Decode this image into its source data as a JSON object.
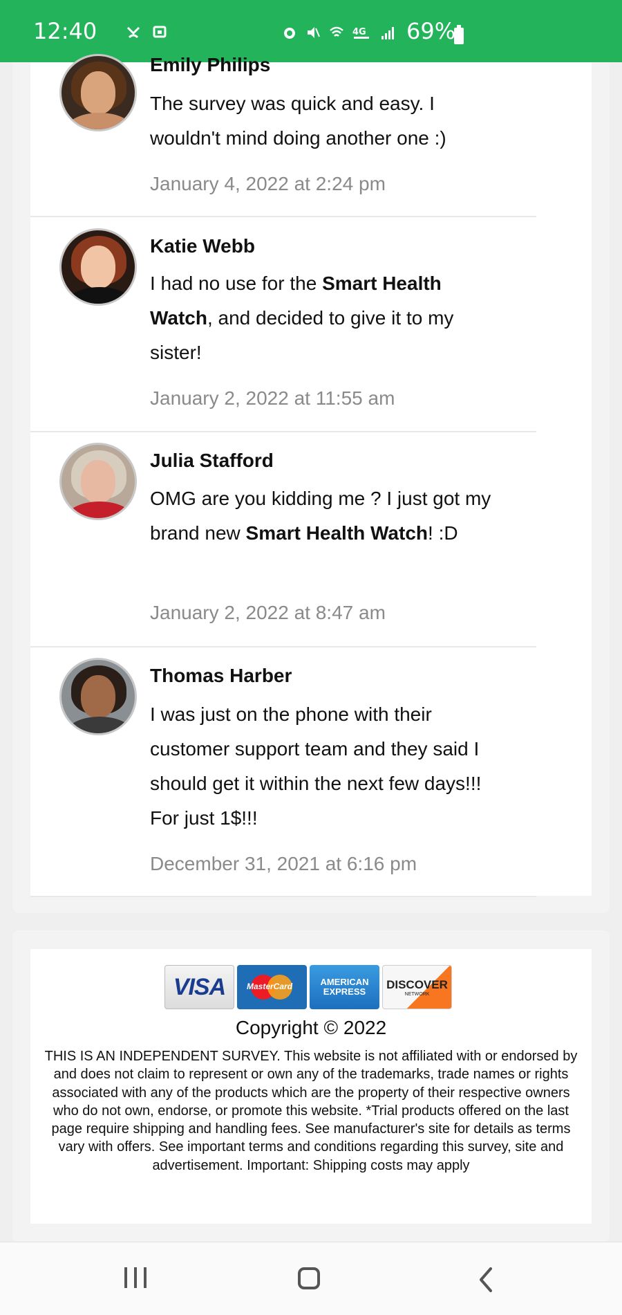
{
  "status_bar": {
    "time": "12:40",
    "battery": "69%"
  },
  "comments": [
    {
      "name": "Emily Philips",
      "text": "The survey was quick and easy. I wouldn't mind doing another one :)",
      "date": "January 4, 2022 at 2:24 pm"
    },
    {
      "name": "Katie Webb",
      "text_before": "I had no use for the ",
      "text_bold": "Smart Health Watch",
      "text_after": ", and decided to give it to my sister!",
      "date": "January 2, 2022 at 11:55 am"
    },
    {
      "name": "Julia Stafford",
      "text_before": "OMG are you kidding me ? I just got my brand new ",
      "text_bold": "Smart Health Watch",
      "text_after": "! :D",
      "date": "January 2, 2022 at 8:47 am"
    },
    {
      "name": "Thomas Harber",
      "text": "I was just on the phone with their customer support team and they said I should get it within the next few days!!! For just 1$!!!",
      "date": "December 31, 2021 at 6:16 pm"
    }
  ],
  "footer": {
    "cards": {
      "visa": "VISA",
      "mastercard": "MasterCard",
      "amex_line1": "AMERICAN",
      "amex_line2": "EXPRESS",
      "discover": "DISCOVER",
      "discover_sub": "NETWORK"
    },
    "copyright": "Copyright © 2022",
    "disclaimer": "THIS IS AN INDEPENDENT SURVEY. This website is not affiliated with or endorsed by and does not claim to represent or own any of the trademarks, trade names or rights associated with any of the products which are the property of their respective owners who do not own, endorse, or promote this website. *Trial products offered on the last page require shipping and handling fees. See manufacturer's site for details as terms vary with offers. See important terms and conditions regarding this survey, site and advertisement. Important: Shipping costs may apply"
  },
  "colors": {
    "status_bar": "#22b35b",
    "date_text": "#8a8a8a"
  }
}
